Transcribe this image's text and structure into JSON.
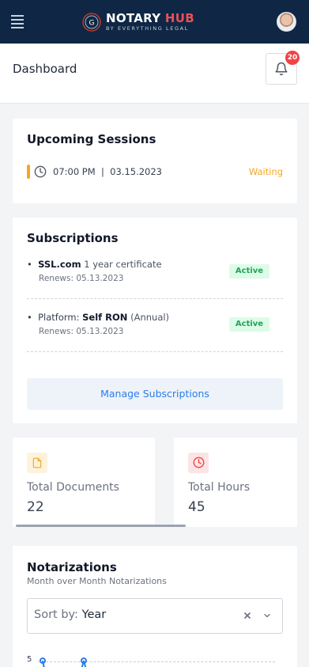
{
  "header": {
    "logo_primary": "NOTARY",
    "logo_accent": "HUB",
    "logo_tagline": "BY EVERYTHING LEGAL",
    "menu_icon": "hamburger-icon",
    "avatar_icon": "user-avatar"
  },
  "subheader": {
    "title": "Dashboard",
    "notification_icon": "bell-icon",
    "notification_count": "20"
  },
  "sessions": {
    "title": "Upcoming Sessions",
    "items": [
      {
        "time": "07:00 PM",
        "separator": "|",
        "date": "03.15.2023",
        "status": "Waiting",
        "status_color": "#f5a623"
      }
    ]
  },
  "subscriptions": {
    "title": "Subscriptions",
    "items": [
      {
        "bullet": "•",
        "name": "SSL.com",
        "detail": "1 year certificate",
        "renews": "Renews: 05.13.2023",
        "status": "Active"
      },
      {
        "bullet": "•",
        "prefix": "Platform:",
        "name": "Self RON",
        "detail": "(Annual)",
        "renews": "Renews: 05.13.2023",
        "status": "Active"
      }
    ],
    "manage_label": "Manage Subscriptions"
  },
  "stats": [
    {
      "label": "Total Documents",
      "value": "22",
      "icon": "document-icon",
      "color": "#f5a623"
    },
    {
      "label": "Total Hours",
      "value": "45",
      "icon": "clock-icon",
      "color": "#ef4444"
    }
  ],
  "notarizations": {
    "title": "Notarizations",
    "subtitle": "Month over Month Notarizations",
    "sort_prefix": "Sort by:",
    "sort_value": "Year",
    "y_tick_top": "5"
  }
}
